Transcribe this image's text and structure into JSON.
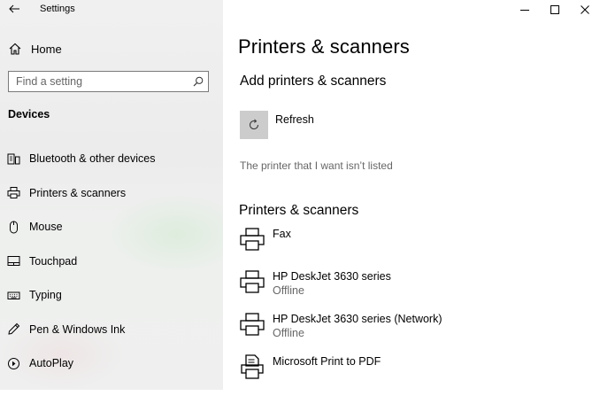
{
  "window": {
    "title": "Settings",
    "controls": [
      "minimize-icon",
      "maximize-icon",
      "close-icon"
    ]
  },
  "sidebar": {
    "home_label": "Home",
    "search_placeholder": "Find a setting",
    "section_title": "Devices",
    "items": [
      {
        "label": "Bluetooth & other devices",
        "icon": "bluetooth-devices-icon"
      },
      {
        "label": "Printers & scanners",
        "icon": "printer-icon"
      },
      {
        "label": "Mouse",
        "icon": "mouse-icon"
      },
      {
        "label": "Touchpad",
        "icon": "touchpad-icon"
      },
      {
        "label": "Typing",
        "icon": "keyboard-icon"
      },
      {
        "label": "Pen & Windows Ink",
        "icon": "pen-icon"
      },
      {
        "label": "AutoPlay",
        "icon": "autoplay-icon"
      }
    ]
  },
  "main": {
    "page_title": "Printers & scanners",
    "add_heading": "Add printers & scanners",
    "refresh_label": "Refresh",
    "not_listed_link": "The printer that I want isn’t listed",
    "printers_heading": "Printers & scanners",
    "printers": [
      {
        "name": "Fax",
        "status": "",
        "icon": "printer-icon"
      },
      {
        "name": "HP DeskJet 3630 series",
        "status": "Offline",
        "icon": "printer-icon"
      },
      {
        "name": "HP DeskJet 3630 series (Network)",
        "status": "Offline",
        "icon": "printer-icon"
      },
      {
        "name": "Microsoft Print to PDF",
        "status": "",
        "icon": "pdf-printer-icon"
      }
    ]
  },
  "colors": {
    "sidebar_bg": "#f0f0f0",
    "tile_bg": "#cccccc",
    "secondary_text": "#666666"
  }
}
